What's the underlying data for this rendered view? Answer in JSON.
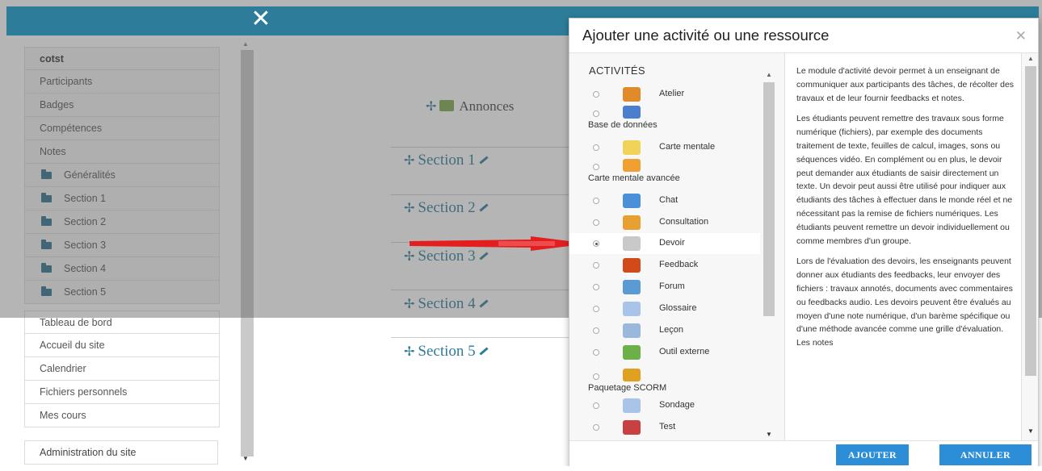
{
  "topbar": {
    "close_icon": "close-icon"
  },
  "drawer": {
    "items": [
      {
        "label": "cotst",
        "bold": true
      },
      {
        "label": "Participants"
      },
      {
        "label": "Badges"
      },
      {
        "label": "Compétences"
      },
      {
        "label": "Notes"
      },
      {
        "label": "Généralités",
        "folder": true
      },
      {
        "label": "Section 1",
        "folder": true
      },
      {
        "label": "Section 2",
        "folder": true
      },
      {
        "label": "Section 3",
        "folder": true
      },
      {
        "label": "Section 4",
        "folder": true
      },
      {
        "label": "Section 5",
        "folder": true
      }
    ],
    "links": [
      "Tableau de bord",
      "Accueil du site",
      "Calendrier",
      "Fichiers personnels",
      "Mes cours"
    ],
    "admin": "Administration du site"
  },
  "course": {
    "annonces": "Annonces",
    "sections": [
      "Section 1",
      "Section 2",
      "Section 3",
      "Section 4",
      "Section 5"
    ]
  },
  "modal": {
    "title": "Ajouter une activité ou une ressource",
    "activities_header": "ACTIVITÉS",
    "activities": [
      {
        "label": "Atelier",
        "icon": "workshop-icon",
        "color": "#e08a2a"
      },
      {
        "label": "Base de données",
        "icon": "database-icon",
        "color": "#4a7fd0",
        "wrap": true
      },
      {
        "label": "Carte mentale",
        "icon": "lightbulb-icon",
        "color": "#f2d35a"
      },
      {
        "label": "Carte mentale avancée",
        "icon": "lightbulb-icon",
        "color": "#f0a030",
        "wrap": true
      },
      {
        "label": "Chat",
        "icon": "chat-icon",
        "color": "#4a90d8"
      },
      {
        "label": "Consultation",
        "icon": "chart-icon",
        "color": "#e8a030"
      },
      {
        "label": "Devoir",
        "icon": "assignment-icon",
        "color": "#c9c9c9",
        "selected": true
      },
      {
        "label": "Feedback",
        "icon": "megaphone-icon",
        "color": "#d04a1a"
      },
      {
        "label": "Forum",
        "icon": "forum-icon",
        "color": "#5b9bd5"
      },
      {
        "label": "Glossaire",
        "icon": "glossary-icon",
        "color": "#a8c4e8"
      },
      {
        "label": "Leçon",
        "icon": "lesson-icon",
        "color": "#9ab8dc"
      },
      {
        "label": "Outil externe",
        "icon": "puzzle-icon",
        "color": "#6cb04a"
      },
      {
        "label": "Paquetage SCORM",
        "icon": "package-icon",
        "color": "#e0a020",
        "wrap": true
      },
      {
        "label": "Sondage",
        "icon": "question-icon",
        "color": "#a8c4e8"
      },
      {
        "label": "Test",
        "icon": "checkmark-icon",
        "color": "#c84040"
      }
    ],
    "description": [
      "Le module d'activité devoir permet à un enseignant de communiquer aux participants des tâches, de récolter des travaux et de leur fournir feedbacks et notes.",
      "Les étudiants peuvent remettre des travaux sous forme numérique (fichiers), par exemple des documents traitement de texte, feuilles de calcul, images, sons ou séquences vidéo. En complément ou en plus, le devoir peut demander aux étudiants de saisir directement un texte. Un devoir peut aussi être utilisé pour indiquer aux étudiants des tâches à effectuer dans le monde réel et ne nécessitant pas la remise de fichiers numériques. Les étudiants peuvent remettre un devoir individuellement ou comme membres d'un groupe.",
      "Lors de l'évaluation des devoirs, les enseignants peuvent donner aux étudiants des feedbacks, leur envoyer des fichiers : travaux annotés, documents avec commentaires ou feedbacks audio. Les devoirs peuvent être évalués au moyen d'une note numérique, d'un barème spécifique ou d'une méthode avancée comme une grille d'évaluation. Les notes"
    ],
    "add_label": "AJOUTER",
    "cancel_label": "ANNULER"
  }
}
